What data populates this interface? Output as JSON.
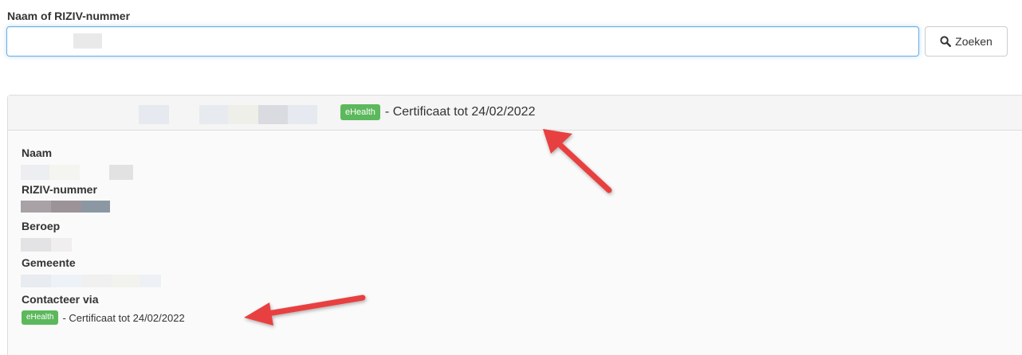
{
  "search": {
    "label": "Naam of RIZIV-nummer",
    "value": "",
    "button_label": "Zoeken",
    "button_icon": "search-icon"
  },
  "result": {
    "header": {
      "badge": "eHealth",
      "certificate_text": "- Certificaat tot 24/02/2022"
    },
    "fields": {
      "name_label": "Naam",
      "riziv_label": "RIZIV-nummer",
      "profession_label": "Beroep",
      "municipality_label": "Gemeente",
      "contact_label": "Contacteer via"
    },
    "contact": {
      "badge": "eHealth",
      "certificate_text": "- Certificaat tot 24/02/2022"
    }
  },
  "colors": {
    "badge_green": "#5cb85c",
    "annotation_arrow": "#e8413f",
    "input_focus_border": "#66afe9"
  }
}
